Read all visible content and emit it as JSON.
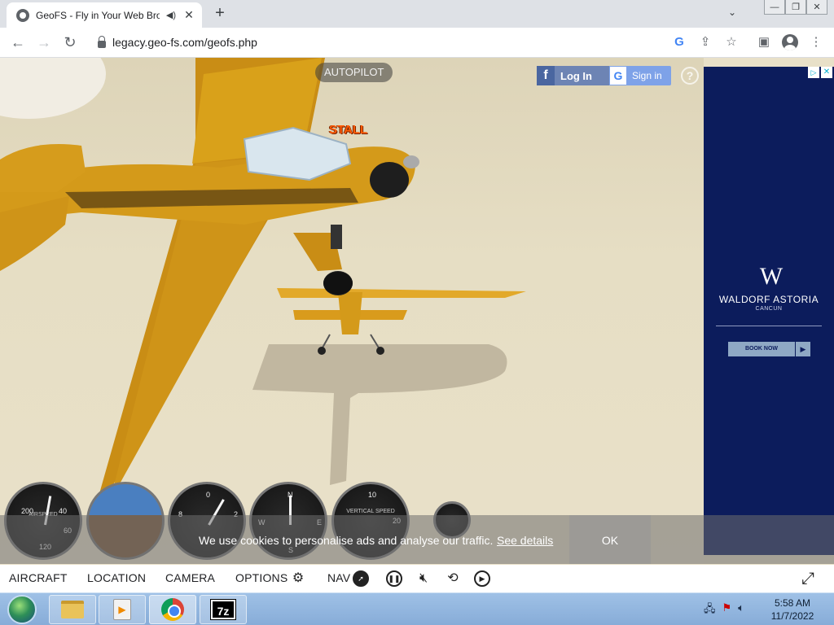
{
  "browser": {
    "tab_title": "GeoFS - Fly in Your Web Bro",
    "url": "legacy.geo-fs.com/geofs.php",
    "window_controls": [
      "minimize-icon",
      "restore-icon",
      "close-icon"
    ]
  },
  "game": {
    "autopilot_label": "AUTOPILOT",
    "stall_label": "STALL",
    "facebook_login_label": "Log In",
    "facebook_icon_glyph": "f",
    "google_signin_label": "Sign in",
    "google_icon_glyph": "G",
    "help_label": "?"
  },
  "gauges": {
    "airspeed": {
      "name": "AIRSPEED",
      "ticks": [
        "200",
        "40",
        "60",
        "120"
      ]
    },
    "altimeter": {
      "ticks": [
        "0",
        "8",
        "2"
      ]
    },
    "heading": {
      "ticks": [
        "N",
        "E",
        "S",
        "W"
      ]
    },
    "vertical_speed": {
      "name": "VERTICAL SPEED",
      "ticks": [
        "10",
        "20"
      ]
    }
  },
  "cookie_banner": {
    "text": "We use cookies to personalise ads and analyse our traffic.",
    "link": "See details",
    "ok": "OK"
  },
  "ad": {
    "badge": "▷",
    "close": "✕",
    "logo": "W",
    "brand": "WALDORF ASTORIA",
    "location": "CANCUN",
    "cta": "BOOK NOW",
    "cta_arrow": "▶"
  },
  "menu": {
    "aircraft": "AIRCRAFT",
    "location": "LOCATION",
    "camera": "CAMERA",
    "options": "OPTIONS",
    "nav": "NAV"
  },
  "taskbar": {
    "time": "5:58 AM",
    "date": "11/7/2022",
    "sevenzip_label": "7z"
  },
  "colors": {
    "sky": "#e6dec4",
    "plane_yellow": "#d9a11a",
    "ad_navy": "#0c1c5c",
    "stall_orange": "#ff5a00"
  }
}
